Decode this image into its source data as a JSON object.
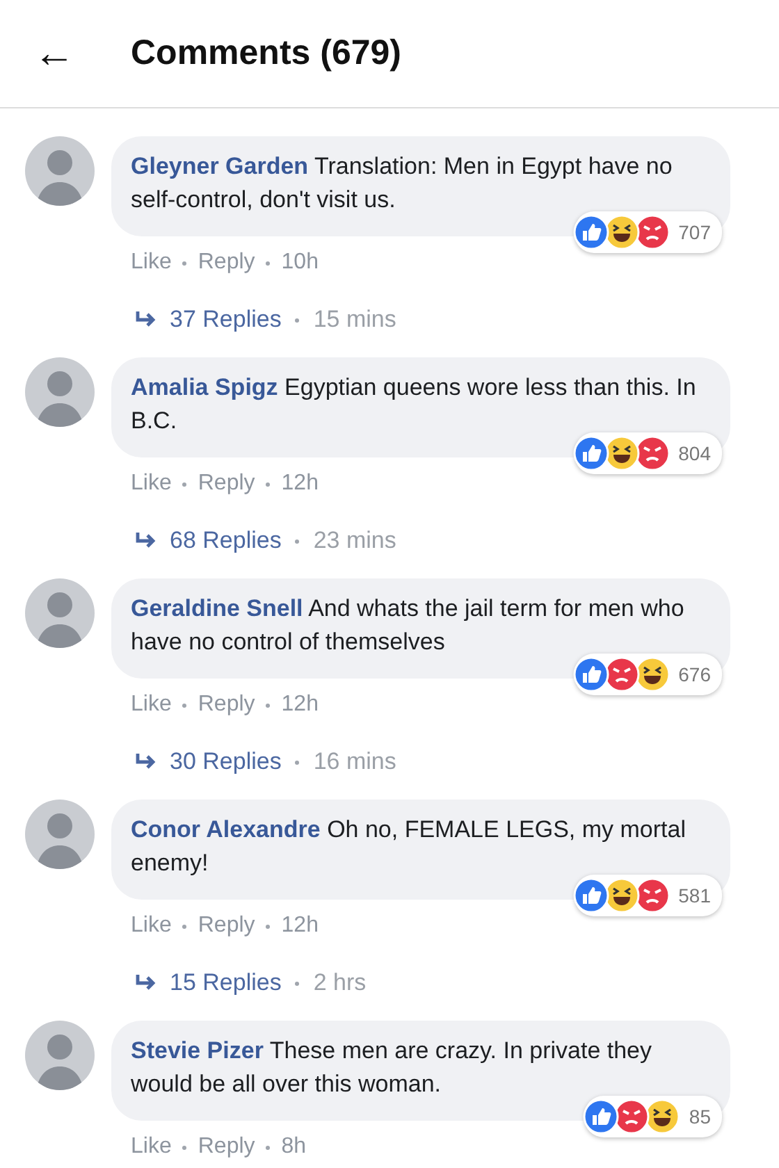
{
  "header": {
    "back": "←",
    "title": "Comments (679)"
  },
  "comments": [
    {
      "author": "Gleyner Garden",
      "text": "Translation: Men in Egypt have no self-control, don't visit us.",
      "reactions": [
        {
          "kind": "like"
        },
        {
          "kind": "haha"
        },
        {
          "kind": "angry"
        }
      ],
      "count": "707",
      "like": "Like",
      "reply": "Reply",
      "time": "10h",
      "replies": "37 Replies",
      "replies_time": "15 mins"
    },
    {
      "author": "Amalia Spigz",
      "text": "Egyptian queens wore less than this. In B.C.",
      "reactions": [
        {
          "kind": "like"
        },
        {
          "kind": "haha"
        },
        {
          "kind": "angry"
        }
      ],
      "count": "804",
      "like": "Like",
      "reply": "Reply",
      "time": "12h",
      "replies": "68 Replies",
      "replies_time": "23 mins"
    },
    {
      "author": "Geraldine Snell",
      "text": "And whats the jail term for men who have no control of themselves",
      "reactions": [
        {
          "kind": "like"
        },
        {
          "kind": "angry"
        },
        {
          "kind": "haha"
        }
      ],
      "count": "676",
      "like": "Like",
      "reply": "Reply",
      "time": "12h",
      "replies": "30 Replies",
      "replies_time": "16 mins"
    },
    {
      "author": "Conor Alexandre",
      "text": "Oh no, FEMALE LEGS, my mortal enemy!",
      "reactions": [
        {
          "kind": "like"
        },
        {
          "kind": "haha"
        },
        {
          "kind": "angry"
        }
      ],
      "count": "581",
      "like": "Like",
      "reply": "Reply",
      "time": "12h",
      "replies": "15 Replies",
      "replies_time": "2 hrs"
    },
    {
      "author": "Stevie Pizer",
      "text": "These men are crazy. In private they would be all over this woman.",
      "reactions": [
        {
          "kind": "like"
        },
        {
          "kind": "angry"
        },
        {
          "kind": "haha"
        }
      ],
      "count": "85",
      "like": "Like",
      "reply": "Reply",
      "time": "8h"
    }
  ]
}
